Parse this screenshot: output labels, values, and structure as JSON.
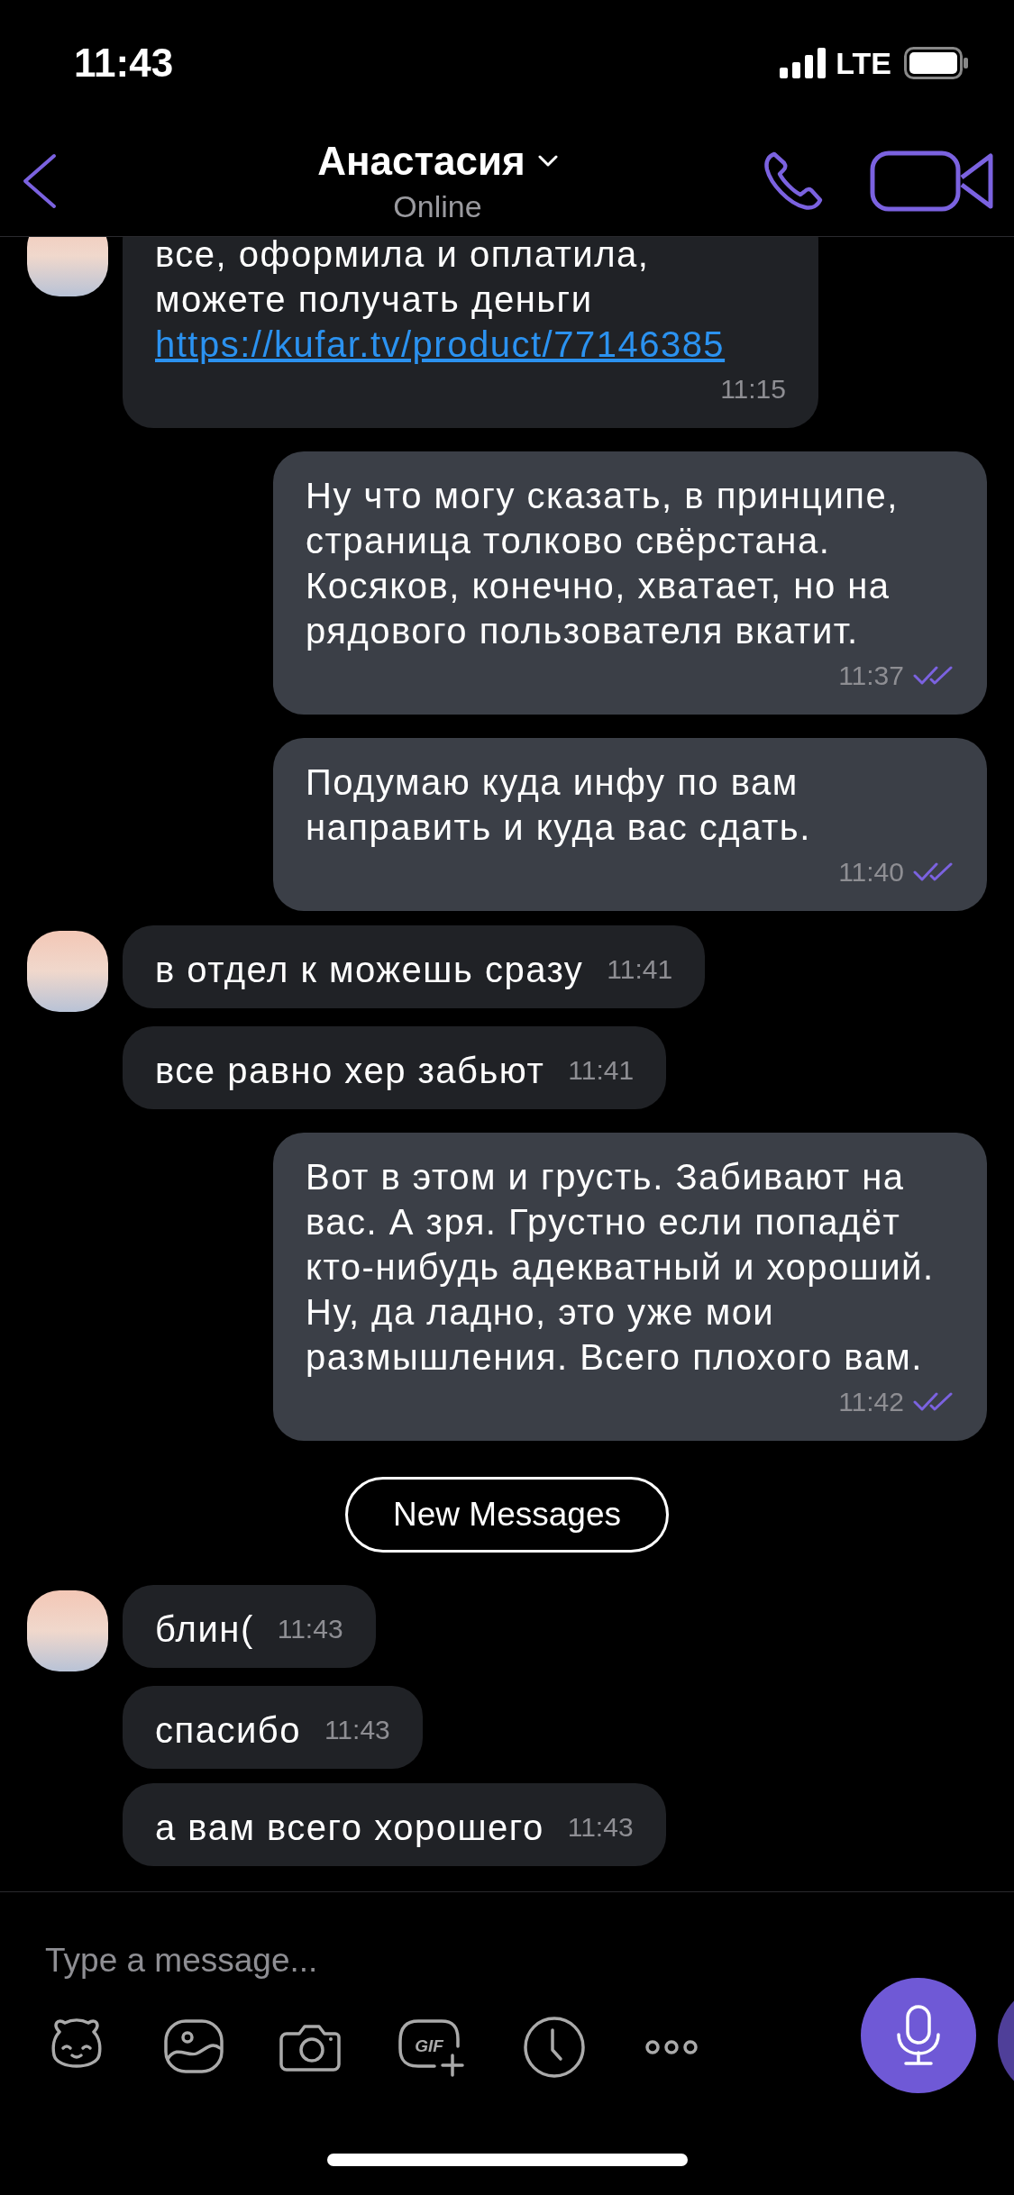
{
  "status_bar": {
    "time": "11:43",
    "network": "LTE"
  },
  "header": {
    "name": "Анастасия",
    "presence": "Online"
  },
  "messages": [
    {
      "kind": "incoming",
      "avatar": true,
      "text": "все, оформила и оплатила, можете получать деньги",
      "link": "https://kufar.tv/product/77146385",
      "time": "11:15"
    },
    {
      "kind": "outgoing",
      "text": "Ну что могу сказать, в принципе, страница толково свёрстана. Косяков, конечно, хватает, но на рядового пользователя вкатит.",
      "time": "11:37",
      "read": true
    },
    {
      "kind": "outgoing",
      "text": "Подумаю куда инфу по вам направить и куда вас сдать.",
      "time": "11:40",
      "read": true
    },
    {
      "kind": "incoming",
      "avatar": true,
      "text": "в отдел к можешь сразу",
      "time": "11:41"
    },
    {
      "kind": "incoming",
      "avatar": false,
      "text": "все равно хер забьют",
      "time": "11:41"
    },
    {
      "kind": "outgoing",
      "text": "Вот в этом и грусть. Забивают на вас. А зря. Грустно если попадёт кто-нибудь адекватный и хороший. Ну, да ладно, это уже мои размышления. Всего плохого вам.",
      "time": "11:42",
      "read": true
    },
    {
      "kind": "divider",
      "text": "New Messages"
    },
    {
      "kind": "incoming",
      "avatar": true,
      "text": "блин(",
      "time": "11:43"
    },
    {
      "kind": "incoming",
      "avatar": false,
      "text": "спасибо",
      "time": "11:43"
    },
    {
      "kind": "incoming",
      "avatar": false,
      "text": "а вам всего хорошего",
      "time": "11:43"
    }
  ],
  "composer": {
    "placeholder": "Type a message...",
    "tools": [
      {
        "kind": "sticker"
      },
      {
        "kind": "gallery"
      },
      {
        "kind": "camera"
      },
      {
        "kind": "gif",
        "label": "GIF"
      },
      {
        "kind": "timer"
      },
      {
        "kind": "more"
      }
    ]
  }
}
